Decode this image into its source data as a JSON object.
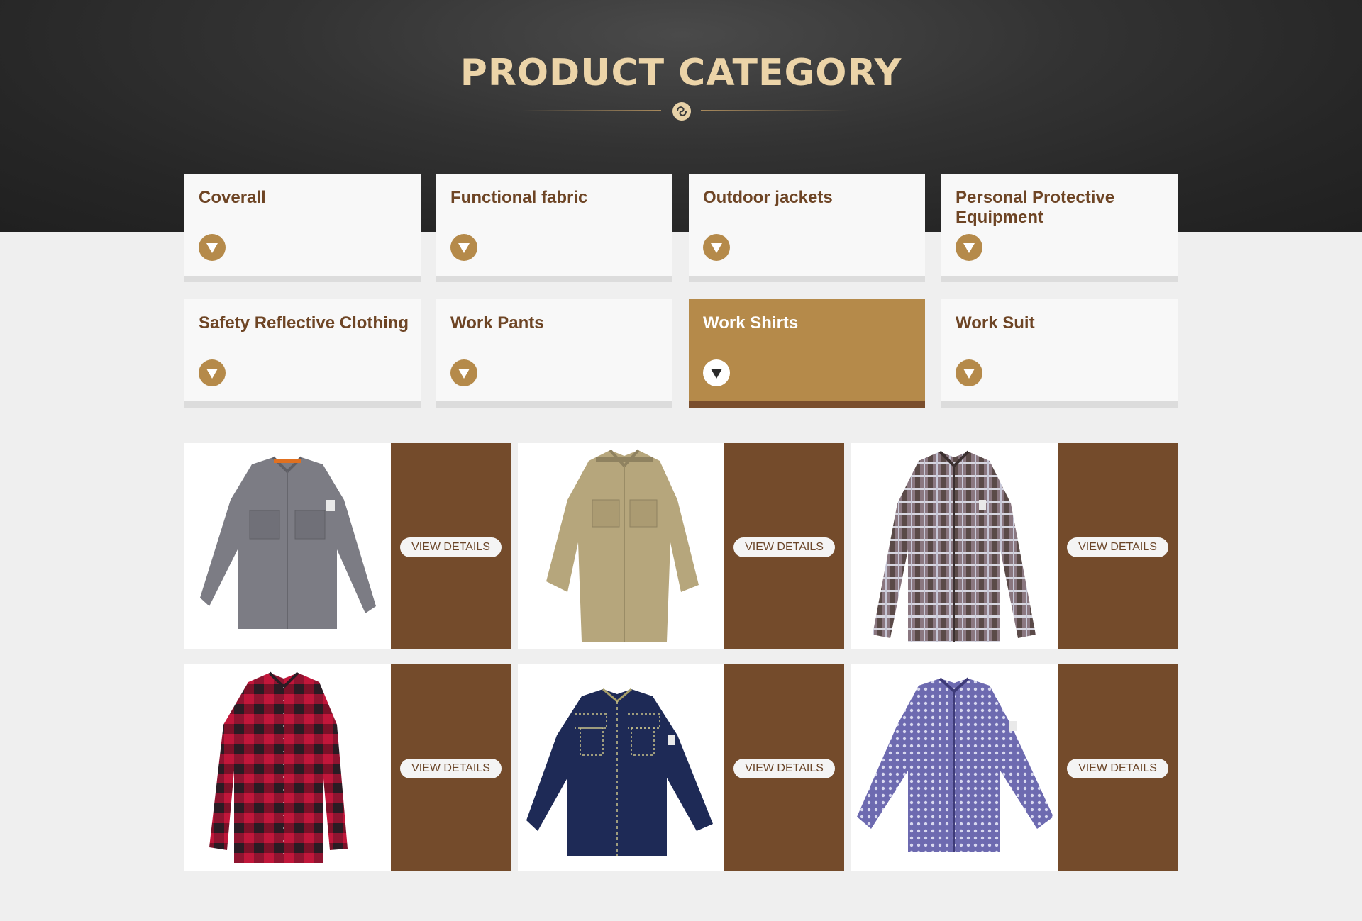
{
  "header": {
    "title": "PRODUCT CATEGORY",
    "emblem_icon": "knot-emblem-icon"
  },
  "colors": {
    "hero_dark": "#262626",
    "title_gold": "#ecd4a8",
    "accent_gold": "#b58a4a",
    "accent_brown": "#744b2b",
    "text_brown": "#6e4525",
    "page_bg": "#efefef"
  },
  "categories": [
    {
      "label": "Coverall",
      "active": false
    },
    {
      "label": "Functional fabric",
      "active": false
    },
    {
      "label": "Outdoor jackets",
      "active": false
    },
    {
      "label": "Personal Protective Equipment",
      "active": false
    },
    {
      "label": "Safety Reflective Clothing",
      "active": false
    },
    {
      "label": "Work Pants",
      "active": false
    },
    {
      "label": "Work Shirts",
      "active": true
    },
    {
      "label": "Work Suit",
      "active": false
    }
  ],
  "products": [
    {
      "image": "grey-work-shirt",
      "button": "VIEW DETAILS"
    },
    {
      "image": "khaki-work-shirt",
      "button": "VIEW DETAILS"
    },
    {
      "image": "brown-plaid-shirt",
      "button": "VIEW DETAILS"
    },
    {
      "image": "red-buffalo-plaid-shirt",
      "button": "VIEW DETAILS"
    },
    {
      "image": "navy-denim-shirt",
      "button": "VIEW DETAILS"
    },
    {
      "image": "blue-print-shirt",
      "button": "VIEW DETAILS"
    }
  ]
}
